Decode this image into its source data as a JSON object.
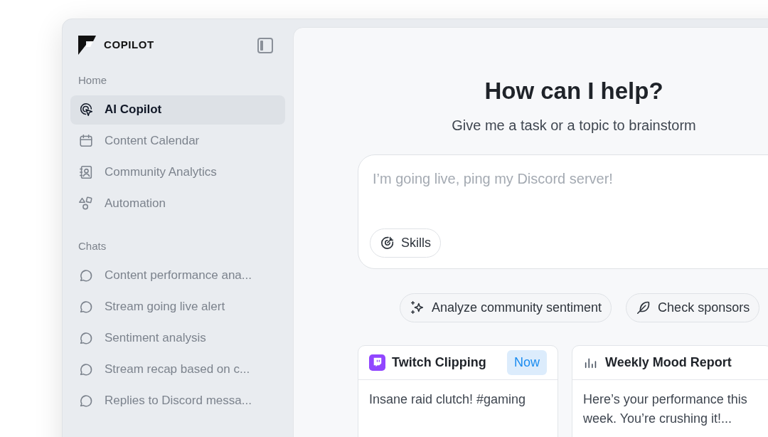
{
  "brand": {
    "name": "COPILOT"
  },
  "sidebar": {
    "sections": [
      {
        "title": "Home",
        "items": [
          {
            "kind": "copilot",
            "label": "AI Copilot",
            "selected": true
          },
          {
            "kind": "calendar",
            "label": "Content Calendar",
            "selected": false
          },
          {
            "kind": "contact",
            "label": "Community Analytics",
            "selected": false
          },
          {
            "kind": "shapes",
            "label": "Automation",
            "selected": false
          }
        ]
      },
      {
        "title": "Chats",
        "items": [
          {
            "kind": "chat",
            "label": "Content performance ana...",
            "selected": false
          },
          {
            "kind": "chat",
            "label": "Stream going live alert",
            "selected": false
          },
          {
            "kind": "chat",
            "label": "Sentiment analysis",
            "selected": false
          },
          {
            "kind": "chat",
            "label": "Stream recap based on c...",
            "selected": false
          },
          {
            "kind": "chat",
            "label": "Replies to Discord messa...",
            "selected": false
          }
        ]
      }
    ]
  },
  "main": {
    "heading": "How can I help?",
    "subheading": "Give me a task or a topic to brainstorm",
    "prompt": {
      "placeholder": "I’m going live, ping my Discord server!",
      "skills_button": "Skills"
    },
    "suggestions": [
      {
        "kind": "sparkles",
        "label": "Analyze community sentiment"
      },
      {
        "kind": "feather",
        "label": "Check sponsors"
      }
    ],
    "cards": [
      {
        "kind": "twitch",
        "title": "Twitch Clipping",
        "badge": "Now",
        "body": "Insane raid clutch! #gaming"
      },
      {
        "kind": "chart",
        "title": "Weekly Mood Report",
        "body": "Here’s your performance this week. You’re crushing it!..."
      }
    ]
  }
}
